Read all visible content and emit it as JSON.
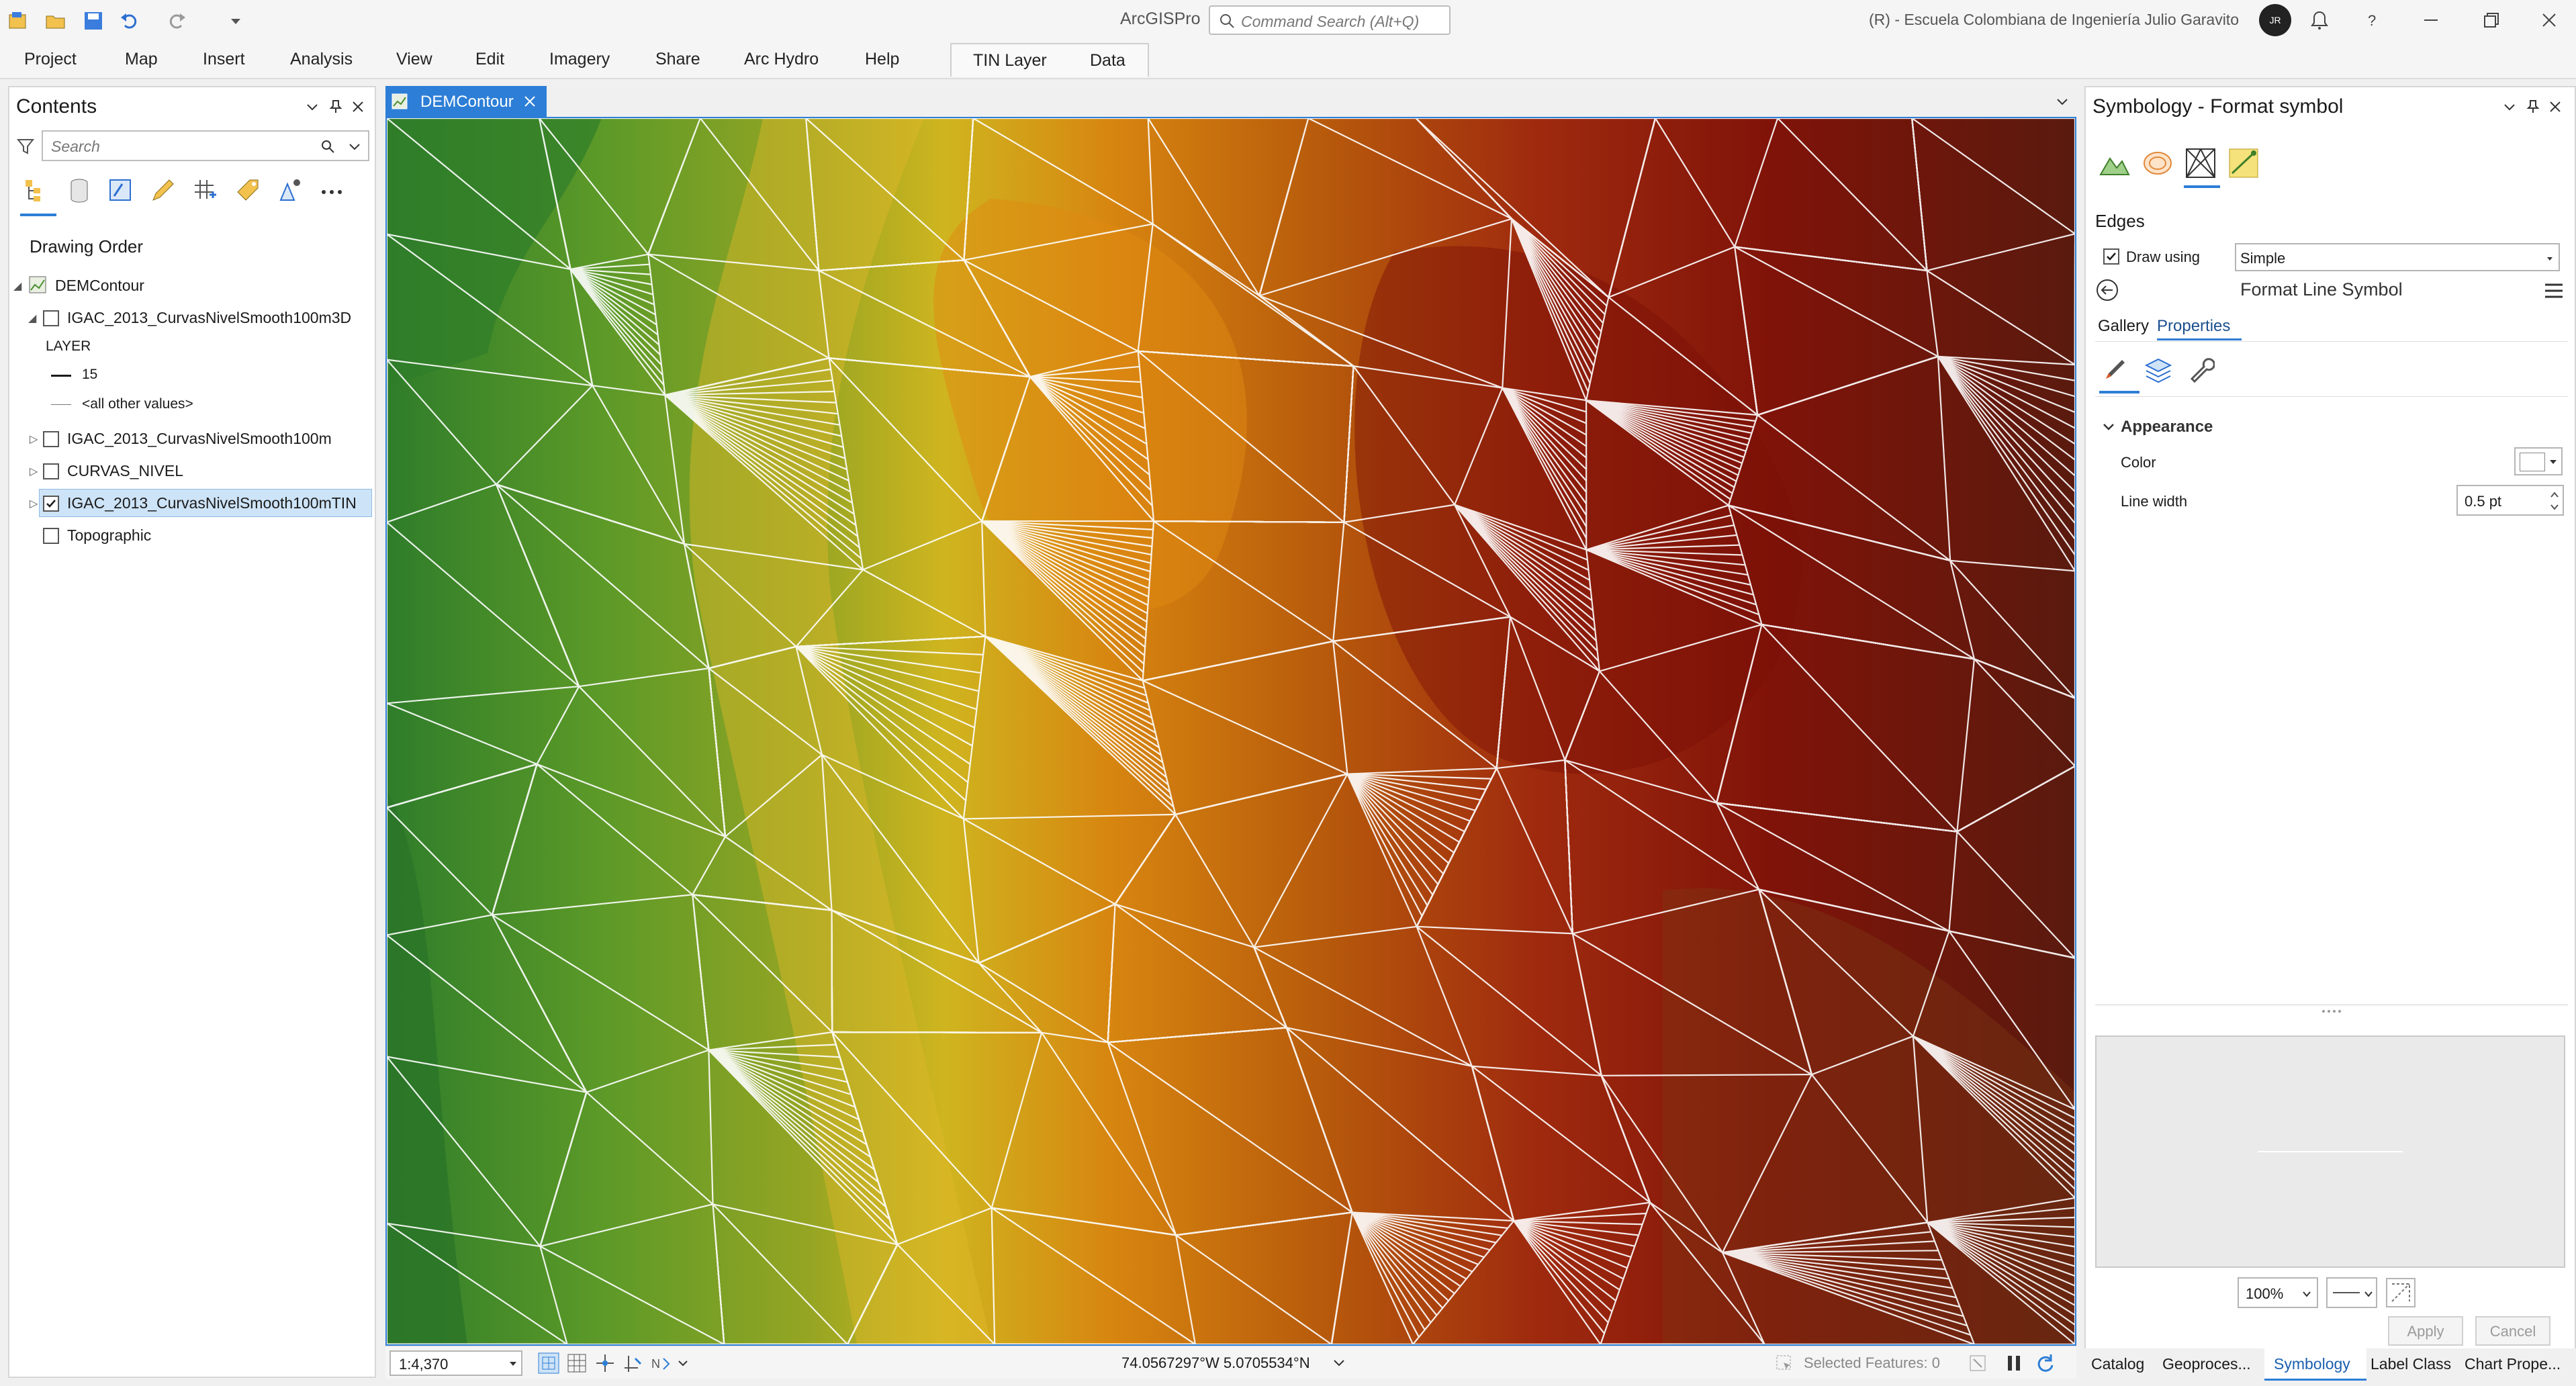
{
  "app": {
    "title": "ArcGISPro",
    "search_placeholder": "Command Search (Alt+Q)",
    "org": "(R) - Escuela Colombiana de Ingeniería Julio Garavito",
    "avatar": "JR"
  },
  "ribbon": {
    "tabs": [
      "Project",
      "Map",
      "Insert",
      "Analysis",
      "View",
      "Edit",
      "Imagery",
      "Share",
      "Arc Hydro",
      "Help"
    ],
    "context_tabs": [
      "TIN Layer",
      "Data"
    ]
  },
  "contents": {
    "title": "Contents",
    "search_placeholder": "Search",
    "drawing_order": "Drawing Order",
    "map_name": "DEMContour",
    "layers": [
      {
        "name": "IGAC_2013_CurvasNivelSmooth100m3D",
        "checked": false,
        "expanded": true
      },
      {
        "name": "IGAC_2013_CurvasNivelSmooth100m",
        "checked": false,
        "expanded": false
      },
      {
        "name": "CURVAS_NIVEL",
        "checked": false,
        "expanded": false
      },
      {
        "name": "IGAC_2013_CurvasNivelSmooth100mTIN",
        "checked": true,
        "expanded": false,
        "selected": true
      },
      {
        "name": "Topographic",
        "checked": false,
        "expanded": false
      }
    ],
    "legend": {
      "field": "LAYER",
      "value": "15",
      "other": "<all other values>"
    }
  },
  "map": {
    "tab": "DEMContour",
    "scale": "1:4,370",
    "coords": "74.0567297°W 5.0705534°N",
    "selected_features": "Selected Features: 0"
  },
  "symbology": {
    "title": "Symbology - Format symbol",
    "section": "Edges",
    "draw_using_label": "Draw using",
    "draw_using_value": "Simple",
    "draw_using_checked": true,
    "format_title": "Format Line Symbol",
    "tabs": [
      "Gallery",
      "Properties"
    ],
    "group": "Appearance",
    "color_label": "Color",
    "color_value": "#ffffff",
    "line_width_label": "Line width",
    "line_width_value": "0.5 pt",
    "zoom": "100%",
    "apply": "Apply",
    "cancel": "Cancel"
  },
  "bottom_tabs": [
    "Catalog",
    "Geoproces...",
    "Symbology",
    "Label Class",
    "Chart Prope..."
  ]
}
